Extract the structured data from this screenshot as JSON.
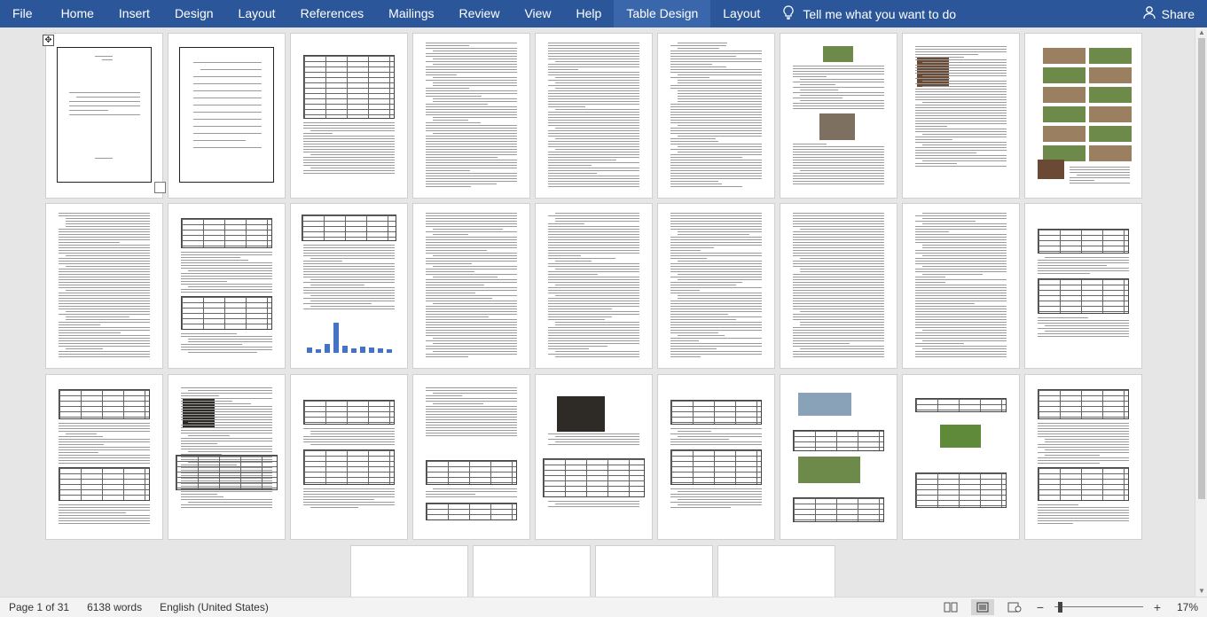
{
  "ribbon": {
    "file": "File",
    "tabs": [
      "Home",
      "Insert",
      "Design",
      "Layout",
      "References",
      "Mailings",
      "Review",
      "View",
      "Help",
      "Table Design",
      "Layout"
    ],
    "active_tab_index": 9,
    "tell_me": "Tell me what you want to do",
    "share": "Share"
  },
  "status": {
    "page": "Page 1 of 31",
    "words": "6138 words",
    "language": "English (United States)",
    "zoom": "17%",
    "zoom_level": 0.17
  },
  "colors": {
    "ribbon": "#2b579a",
    "active_tab": "#3a66ab",
    "canvas": "#e6e6e6"
  },
  "icons": {
    "tell_me": "lightbulb-icon",
    "share": "person-icon",
    "move": "table-move-icon"
  }
}
